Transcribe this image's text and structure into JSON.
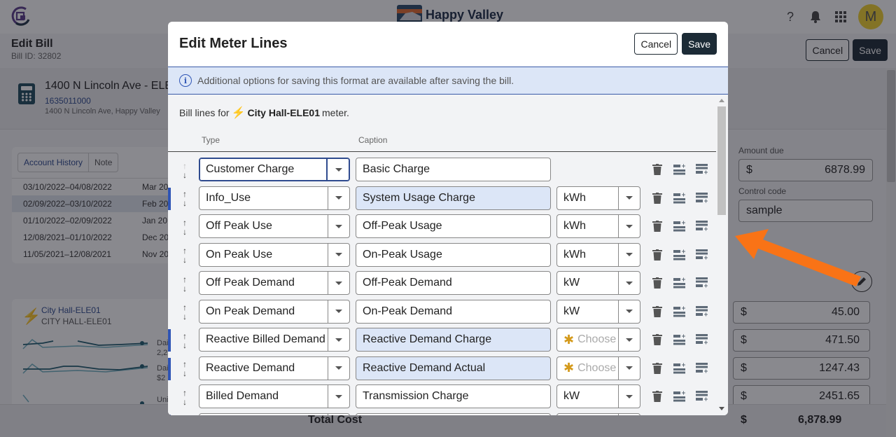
{
  "header": {
    "brand_name": "Happy Valley",
    "avatar_initial": "M",
    "icons": [
      "help-icon",
      "bell-icon",
      "apps-grid-icon"
    ]
  },
  "page": {
    "title": "Edit Bill",
    "bill_id": "Bill ID: 32802",
    "cancel_label": "Cancel",
    "save_label": "Save"
  },
  "account": {
    "name": "1400 N Lincoln Ave - ELE",
    "number": "1635011000",
    "address": "1400 N Lincoln Ave, Happy Valley"
  },
  "history": {
    "tabs": [
      "Account History",
      "Note"
    ],
    "rows": [
      {
        "range": "03/10/2022–04/08/2022",
        "month": "Mar 20",
        "selected": false
      },
      {
        "range": "02/09/2022–03/10/2022",
        "month": "Feb 20",
        "selected": true
      },
      {
        "range": "01/10/2022–02/09/2022",
        "month": "Jan 20",
        "selected": false
      },
      {
        "range": "12/08/2021–01/10/2022",
        "month": "Dec 20",
        "selected": false
      },
      {
        "range": "11/05/2021–12/08/2021",
        "month": "Nov 20",
        "selected": false
      }
    ]
  },
  "meter_card": {
    "link": "City Hall-ELE01",
    "subtitle": "CITY HALL-ELE01",
    "sparklines": [
      {
        "label": "Dai",
        "value": "2,2"
      },
      {
        "label": "Dai",
        "value": "$2"
      },
      {
        "label": "Uni",
        "value": ""
      }
    ]
  },
  "right_panel": {
    "amount_due_label": "Amount due",
    "amount_due_currency": "$",
    "amount_due_value": "6878.99",
    "control_code_label": "Control code",
    "control_code_value": "sample",
    "cost_currency": "$",
    "costs": [
      "45.00",
      "471.50",
      "1247.43",
      "2451.65"
    ]
  },
  "totals": {
    "label": "Total Cost",
    "currency": "$",
    "value": "6,878.99"
  },
  "modal": {
    "title": "Edit Meter Lines",
    "cancel_label": "Cancel",
    "save_label": "Save",
    "info_text": "Additional options for saving this format are available after saving the bill.",
    "lines_for_prefix": "Bill lines for",
    "meter_name": "City Hall-ELE01",
    "lines_for_suffix": "meter.",
    "col_type": "Type",
    "col_caption": "Caption",
    "unit_placeholder": "Choose",
    "rows": [
      {
        "type": "Customer Charge",
        "caption": "Basic Charge",
        "unit": null,
        "highlighted": false,
        "marker": false,
        "focused": true,
        "up_disabled": true
      },
      {
        "type": "Info_Use",
        "caption": "System Usage Charge",
        "unit": "kWh",
        "highlighted": true,
        "marker": true,
        "focused": false,
        "up_disabled": false
      },
      {
        "type": "Off Peak Use",
        "caption": "Off-Peak Usage",
        "unit": "kWh",
        "highlighted": false,
        "marker": false,
        "focused": false,
        "up_disabled": false
      },
      {
        "type": "On Peak Use",
        "caption": "On-Peak Usage",
        "unit": "kWh",
        "highlighted": false,
        "marker": false,
        "focused": false,
        "up_disabled": false
      },
      {
        "type": "Off Peak Demand",
        "caption": "Off-Peak Demand",
        "unit": "kW",
        "highlighted": false,
        "marker": false,
        "focused": false,
        "up_disabled": false
      },
      {
        "type": "On Peak Demand",
        "caption": "On-Peak Demand",
        "unit": "kW",
        "highlighted": false,
        "marker": false,
        "focused": false,
        "up_disabled": false
      },
      {
        "type": "Reactive Billed Demand",
        "caption": "Reactive Demand Charge",
        "unit": "",
        "highlighted": true,
        "marker": true,
        "focused": false,
        "up_disabled": false
      },
      {
        "type": "Reactive Demand",
        "caption": "Reactive Demand Actual",
        "unit": "",
        "highlighted": true,
        "marker": true,
        "focused": false,
        "up_disabled": false
      },
      {
        "type": "Billed Demand",
        "caption": "Transmission Charge",
        "unit": "kW",
        "highlighted": false,
        "marker": false,
        "focused": false,
        "up_disabled": false
      },
      {
        "type": "",
        "caption": "",
        "unit": "",
        "highlighted": false,
        "marker": true,
        "focused": false,
        "up_disabled": false
      }
    ]
  },
  "colors": {
    "accent_blue": "#2f55b5",
    "dark_button": "#1c2b36",
    "bolt": "#f0a020",
    "highlight_bg": "#dce6f7",
    "annotation_arrow": "#f97316"
  }
}
